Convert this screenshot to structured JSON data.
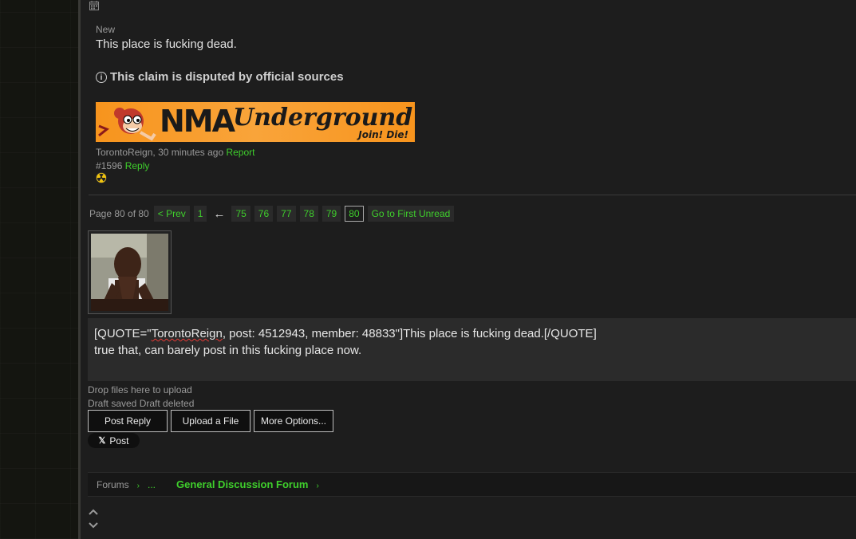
{
  "post": {
    "new_label": "New",
    "text": "This place is fucking dead.",
    "disputed_text": "This claim is disputed by official sources",
    "banner": {
      "nma": "NMA",
      "underground": "Underground",
      "join": "Join! Die!"
    },
    "author": "TorontoReign",
    "time": "30 minutes ago",
    "report_label": "Report",
    "post_number": "#1596",
    "reply_label": "Reply"
  },
  "pagination": {
    "label": "Page 80 of 80",
    "prev": "< Prev",
    "first": "1",
    "ellipsis_arrow": "←",
    "pages": [
      "75",
      "76",
      "77",
      "78",
      "79"
    ],
    "current": "80",
    "first_unread": "Go to First Unread"
  },
  "editor": {
    "quote_pre": "[QUOTE=\"",
    "quote_name": "TorontoReign",
    "quote_post": ", post: 4512943, member: 48833\"]This place is fucking dead.[/QUOTE]",
    "line2": "true that, can barely post in this fucking place now."
  },
  "status": {
    "drop": "Drop files here to upload",
    "draft": "Draft saved Draft deleted"
  },
  "buttons": {
    "post_reply": "Post Reply",
    "upload": "Upload a File",
    "more": "More Options...",
    "x_post": "Post"
  },
  "breadcrumb": {
    "forums": "Forums",
    "ellipsis": "...",
    "forum": "General Discussion Forum"
  },
  "colors": {
    "accent": "#3fcf2c",
    "background": "#1d1d1d",
    "editor_bg": "#2b2b2b"
  }
}
